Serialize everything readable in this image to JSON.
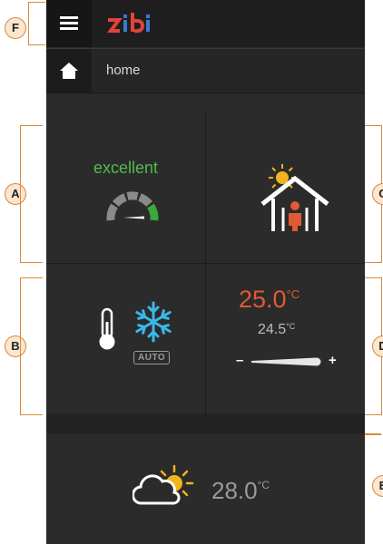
{
  "header": {
    "menu_icon": "hamburger-icon",
    "logo_text": "zibi"
  },
  "breadcrumb": {
    "home_icon": "home-icon",
    "label": "home"
  },
  "tiles": {
    "air_quality": {
      "label": "excellent",
      "label_color": "#4fbd4a",
      "gauge_icon": "gauge-icon"
    },
    "presence": {
      "icon": "house-sun-person-icon"
    },
    "climate_mode": {
      "mode_label": "AUTO",
      "icons": [
        "thermometer-icon",
        "snowflake-icon"
      ]
    },
    "thermostat": {
      "current_temp": "25.0",
      "current_unit": "°C",
      "target_temp": "24.5",
      "target_unit": "°C",
      "minus_label": "–",
      "plus_label": "+",
      "accent": "#e25a34"
    },
    "weather": {
      "icon": "partly-cloudy-icon",
      "temp": "28.0",
      "unit": "°C"
    }
  },
  "callouts": [
    "F",
    "A",
    "B",
    "C",
    "D",
    "E"
  ]
}
